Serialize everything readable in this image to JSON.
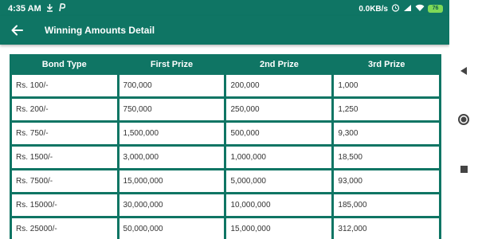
{
  "status_bar": {
    "time": "4:35 AM",
    "speed": "0.0KB/s",
    "battery": "76",
    "colors": {
      "bar": "#0f7564",
      "battery": "#7ed957"
    }
  },
  "app_bar": {
    "title": "Winning Amounts Detail",
    "back_icon": "arrow-left-icon"
  },
  "table": {
    "headers": [
      "Bond Type",
      "First Prize",
      "2nd Prize",
      "3rd Prize"
    ],
    "rows": [
      [
        "Rs. 100/-",
        "700,000",
        "200,000",
        "1,000"
      ],
      [
        "Rs. 200/-",
        "750,000",
        "250,000",
        "1,250"
      ],
      [
        "Rs. 750/-",
        "1,500,000",
        "500,000",
        "9,300"
      ],
      [
        "Rs. 1500/-",
        "3,000,000",
        "1,000,000",
        "18,500"
      ],
      [
        "Rs. 7500/-",
        "15,000,000",
        "5,000,000",
        "93,000"
      ],
      [
        "Rs. 15000/-",
        "30,000,000",
        "10,000,000",
        "185,000"
      ],
      [
        "Rs. 25000/-",
        "50,000,000",
        "15,000,000",
        "312,000"
      ]
    ],
    "accent_color": "#0f7564"
  },
  "nav_bar": {
    "icons": [
      "back-triangle-icon",
      "home-circle-icon",
      "recents-square-icon"
    ]
  }
}
